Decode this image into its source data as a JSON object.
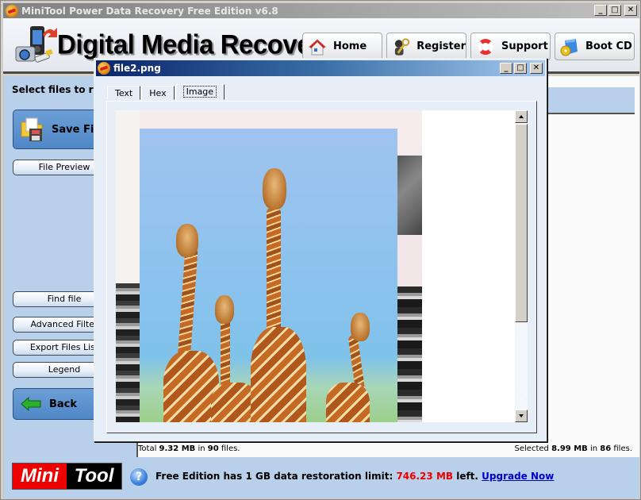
{
  "main_window": {
    "title": "MiniTool Power Data Recovery Free Edition v6.8",
    "controls": {
      "minimize": "_",
      "maximize": "□",
      "close": "✕"
    }
  },
  "header": {
    "brand_title": "Digital Media Recovery",
    "logo_icon": "digital-media-devices-icon",
    "nav_buttons": [
      {
        "label": "Home",
        "icon": "home-icon"
      },
      {
        "label": "Register",
        "icon": "register-keys-icon"
      },
      {
        "label": "Support",
        "icon": "lifebuoy-icon"
      },
      {
        "label": "Boot CD",
        "icon": "boot-cd-icon"
      }
    ]
  },
  "left_panel": {
    "prompt": "Select files to recover",
    "save_files_label": "Save Files",
    "file_preview_label": "File Preview",
    "find_file_label": "Find file",
    "advanced_filter_label": "Advanced Filter",
    "export_files_list_label": "Export Files List",
    "legend_label": "Legend",
    "back_label": "Back"
  },
  "status": {
    "total_prefix": "Total ",
    "total_size": "9.32 MB",
    "total_mid": " in ",
    "total_count": "90",
    "total_suffix": " files.",
    "selected_prefix": "Selected ",
    "selected_size": "8.99 MB",
    "selected_mid": " in ",
    "selected_count": "86",
    "selected_suffix": " files."
  },
  "footer": {
    "logo_left": "Mini",
    "logo_right": "Tool",
    "limit_prefix": "Free Edition has 1 GB data restoration limit: ",
    "limit_remaining": "746.23 MB",
    "limit_suffix": " left. ",
    "upgrade_link": "Upgrade Now",
    "accent_red": "#e00000",
    "link_blue": "#0000cc"
  },
  "preview_dialog": {
    "title": "file2.png",
    "tabs": [
      {
        "label": "Text",
        "active": false
      },
      {
        "label": "Hex",
        "active": false
      },
      {
        "label": "Image",
        "active": true
      }
    ],
    "image_description": "Photo of a poster with four giraffes against a blue sky",
    "controls": {
      "minimize": "_",
      "maximize": "□",
      "close": "✕"
    }
  }
}
